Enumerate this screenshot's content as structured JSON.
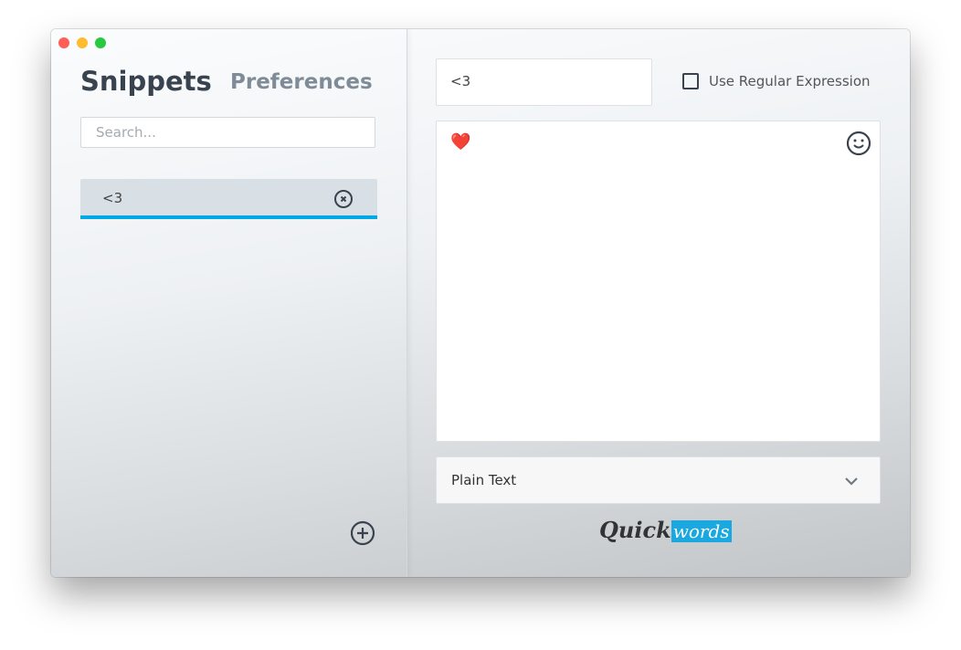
{
  "tabs": {
    "snippets": "Snippets",
    "preferences": "Preferences"
  },
  "search": {
    "placeholder": "Search..."
  },
  "snippets": [
    {
      "label": "<3"
    }
  ],
  "editor": {
    "keyword": "<3",
    "regex_label": "Use Regular Expression",
    "regex_checked": false,
    "content": "❤️",
    "format": "Plain Text"
  },
  "logo": {
    "part1": "Quick",
    "part2": "words"
  },
  "colors": {
    "accent": "#00a8e6"
  }
}
